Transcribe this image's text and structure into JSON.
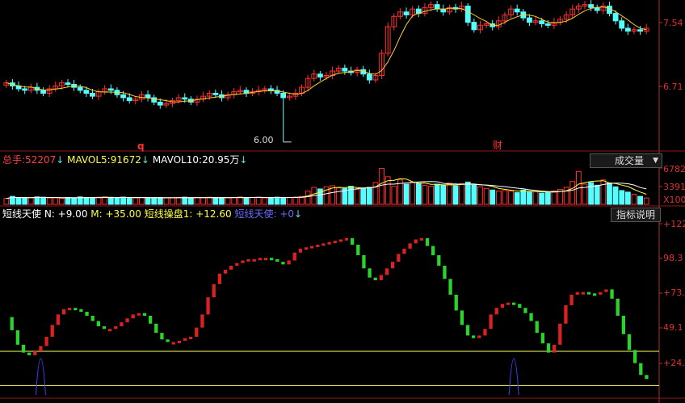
{
  "price_panel": {
    "axis_labels": [
      "7.54",
      "6.71"
    ],
    "min_annotation": "6.00",
    "marker_q": "q",
    "marker_cai": "财"
  },
  "volume_panel": {
    "legend": {
      "total": {
        "label": "总手:",
        "value": "52207",
        "arrow": "↓"
      },
      "mavol5": {
        "label": "MAVOL5:",
        "value": "91672",
        "arrow": "↓"
      },
      "mavol10": {
        "label": "MAVOL10:",
        "value": "20.95万",
        "arrow": "↓"
      }
    },
    "dropdown_label": "成交量",
    "dropdown_arrow": "▼",
    "axis_labels": [
      "6782",
      "3391",
      "X100"
    ]
  },
  "indicator_panel": {
    "legend": {
      "name": "短线天使",
      "n": "N: +9.00",
      "m": "M: +35.00",
      "caopan": "短线操盘1: +12.60",
      "tianshi": "短线天使: +0",
      "arrow": "↓"
    },
    "button_label": "指标说明",
    "axis_labels": [
      "+122",
      "98.3",
      "+73.0",
      "49.1",
      "+24.7"
    ]
  },
  "colors": {
    "up": "#ff3030",
    "down": "#54ffff",
    "ma": "#ffcc33",
    "ind_up": "#dd2020",
    "ind_down": "#2bd42b",
    "spike": "#4040ff",
    "hline": "#ffff66",
    "axis": "#b03030",
    "frame": "#8a1a1a"
  },
  "chart_data": {
    "type": "candlestick",
    "price_ylim": [
      5.9,
      7.9
    ],
    "price_ticks": [
      7.54,
      6.71
    ],
    "price_min_marked": 6.0,
    "closes": [
      6.8,
      6.76,
      6.72,
      6.7,
      6.74,
      6.7,
      6.66,
      6.72,
      6.76,
      6.8,
      6.78,
      6.74,
      6.7,
      6.66,
      6.62,
      6.68,
      6.72,
      6.7,
      6.64,
      6.6,
      6.56,
      6.58,
      6.64,
      6.6,
      6.54,
      6.5,
      6.52,
      6.56,
      6.6,
      6.58,
      6.54,
      6.58,
      6.62,
      6.66,
      6.64,
      6.6,
      6.64,
      6.68,
      6.7,
      6.66,
      6.68,
      6.7,
      6.72,
      6.7,
      6.66,
      6.6,
      6.62,
      6.66,
      6.74,
      6.86,
      6.92,
      6.88,
      6.9,
      6.96,
      7.0,
      6.96,
      6.94,
      6.98,
      6.92,
      6.84,
      6.9,
      7.2,
      7.56,
      7.7,
      7.76,
      7.72,
      7.8,
      7.74,
      7.82,
      7.86,
      7.8,
      7.76,
      7.82,
      7.8,
      7.84,
      7.62,
      7.52,
      7.58,
      7.6,
      7.56,
      7.64,
      7.72,
      7.8,
      7.76,
      7.68,
      7.62,
      7.64,
      7.6,
      7.58,
      7.62,
      7.66,
      7.72,
      7.8,
      7.84,
      7.86,
      7.82,
      7.78,
      7.84,
      7.74,
      7.64,
      7.54,
      7.5,
      7.52,
      7.5,
      7.54
    ],
    "volume_ticks": [
      6782,
      3391
    ],
    "volume_unit": "X100",
    "volume_ylim": [
      0,
      7000
    ],
    "volumes": [
      1100,
      1500,
      1300,
      1200,
      1250,
      1400,
      1350,
      1200,
      1250,
      1100,
      1300,
      1200,
      1400,
      1300,
      1250,
      1350,
      1400,
      1300,
      1200,
      1350,
      1250,
      1200,
      1300,
      1250,
      1150,
      1300,
      1200,
      1250,
      1300,
      1350,
      1200,
      1300,
      1250,
      1350,
      1300,
      1200,
      1250,
      1300,
      1400,
      1250,
      1300,
      1350,
      1200,
      1300,
      1350,
      1250,
      1300,
      1350,
      1500,
      2500,
      3200,
      2900,
      3300,
      3500,
      3100,
      3000,
      3400,
      2800,
      3000,
      3200,
      4100,
      6782,
      5200,
      3400,
      4600,
      3800,
      4200,
      3900,
      3600,
      3400,
      3800,
      3600,
      4000,
      3500,
      3900,
      4200,
      3600,
      3300,
      3000,
      2700,
      2500,
      2600,
      2500,
      2200,
      2700,
      2300,
      2400,
      2100,
      2200,
      2500,
      2800,
      3200,
      4300,
      6200,
      3800,
      4100,
      3600,
      4600,
      4000,
      3300,
      2600,
      2300,
      1900,
      1500,
      1200
    ],
    "indicator_ylim": [
      0,
      135
    ],
    "indicator_ticks": [
      122,
      98.3,
      73.0,
      49.1,
      24.7
    ],
    "hlines": [
      35,
      9
    ],
    "indicator": [
      61,
      51,
      40,
      34,
      32,
      35,
      39,
      46,
      55,
      63,
      67,
      68,
      67,
      65,
      62,
      58,
      54,
      52,
      52,
      54,
      57,
      60,
      63,
      64,
      62,
      56,
      49,
      44,
      42,
      42,
      43,
      45,
      46,
      53,
      63,
      76,
      86,
      94,
      97,
      100,
      102,
      104,
      105,
      105,
      106,
      106,
      105,
      103,
      101,
      104,
      110,
      113,
      114,
      115,
      116,
      117,
      118,
      119,
      120,
      121,
      116,
      108,
      98,
      91,
      89,
      93,
      98,
      103,
      109,
      113,
      117,
      120,
      121,
      115,
      108,
      100,
      90,
      78,
      66,
      55,
      47,
      45,
      47,
      52,
      63,
      68,
      71,
      72,
      71,
      68,
      64,
      58,
      49,
      41,
      34,
      40,
      56,
      70,
      78,
      80,
      80,
      79,
      78,
      80,
      82,
      75,
      62,
      48,
      36,
      26,
      17,
      14
    ]
  }
}
